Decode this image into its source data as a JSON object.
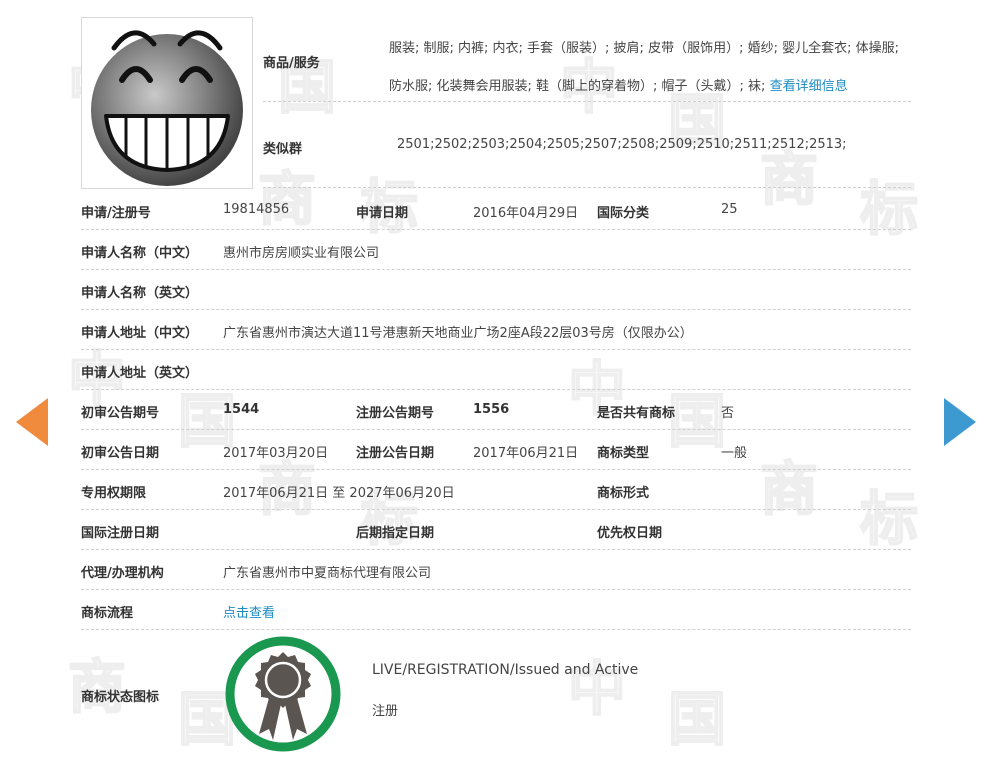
{
  "watermarks": [
    "中",
    "国",
    "商",
    "标"
  ],
  "goods": {
    "label": "商品/服务",
    "value": "服装; 制服; 内裤; 内衣; 手套（服装）; 披肩; 皮带（服饰用）; 婚纱; 婴儿全套衣; 体操服; 防水服; 化装舞会用服装; 鞋（脚上的穿着物）; 帽子（头戴）; 袜;",
    "more_link": "查看详细信息"
  },
  "similar": {
    "label": "类似群",
    "value": "2501;2502;2503;2504;2505;2507;2508;2509;2510;2511;2512;2513;"
  },
  "rows": {
    "reg_no_label": "申请/注册号",
    "reg_no": "19814856",
    "app_date_label": "申请日期",
    "app_date": "2016年04月29日",
    "intl_class_label": "国际分类",
    "intl_class": "25",
    "applicant_cn_label": "申请人名称（中文）",
    "applicant_cn": "惠州市房房顺实业有限公司",
    "applicant_en_label": "申请人名称（英文）",
    "address_cn_label": "申请人地址（中文）",
    "address_cn": "广东省惠州市演达大道11号港惠新天地商业广场2座A段22层03号房（仅限办公）",
    "address_en_label": "申请人地址（英文）",
    "prelim_no_label": "初审公告期号",
    "prelim_no": "1544",
    "reg_pub_no_label": "注册公告期号",
    "reg_pub_no": "1556",
    "shared_label": "是否共有商标",
    "shared": "否",
    "prelim_date_label": "初审公告日期",
    "prelim_date": "2017年03月20日",
    "reg_pub_date_label": "注册公告日期",
    "reg_pub_date": "2017年06月21日",
    "tm_type_label": "商标类型",
    "tm_type": "一般",
    "term_label": "专用权期限",
    "term": "2017年06月21日 至 2027年06月20日",
    "tm_form_label": "商标形式",
    "intl_reg_label": "国际注册日期",
    "later_designation_label": "后期指定日期",
    "priority_label": "优先权日期",
    "agent_label": "代理/办理机构",
    "agent": "广东省惠州市中夏商标代理有限公司",
    "flow_label": "商标流程",
    "flow_link": "点击查看",
    "status_label": "商标状态图标",
    "status_en": "LIVE/REGISTRATION/Issued and Active",
    "status_cn": "注册"
  },
  "colors": {
    "link": "#1e8bc3",
    "arrow_left": "#f08a3c",
    "arrow_right": "#3d9ad1",
    "seal_ring": "#1a9850",
    "seal_medal": "#5b5552"
  },
  "icons": {
    "logo": "grinning-face-icon",
    "prev": "arrow-left-icon",
    "next": "arrow-right-icon",
    "status": "registered-seal-icon"
  }
}
